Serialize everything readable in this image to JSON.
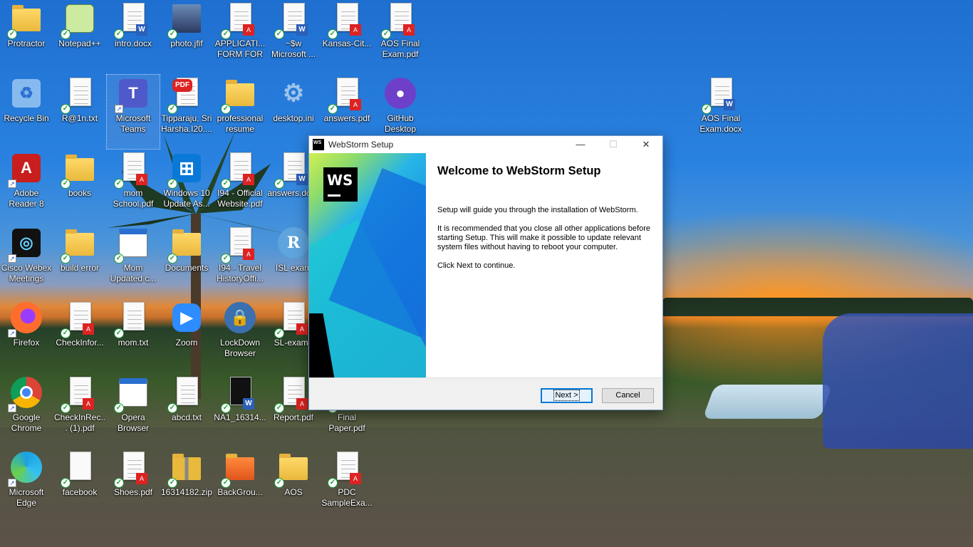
{
  "desktop": {
    "icons": [
      {
        "label": "Protractor",
        "kind": "folder"
      },
      {
        "label": "Notepad++",
        "kind": "notepadpp"
      },
      {
        "label": "intro.docx",
        "kind": "word"
      },
      {
        "label": "photo.jfif",
        "kind": "photo"
      },
      {
        "label": "APPLICATI... FORM FOR ...",
        "kind": "pdf"
      },
      {
        "label": "~$w Microsoft ...",
        "kind": "word"
      },
      {
        "label": "Kansas-Cit...",
        "kind": "pdf"
      },
      {
        "label": "AOS Final Exam.pdf",
        "kind": "pdf"
      },
      {
        "label": "Recycle Bin",
        "kind": "recycle"
      },
      {
        "label": "R@1n.txt",
        "kind": "txt"
      },
      {
        "label": "Microsoft Teams",
        "kind": "teams"
      },
      {
        "label": "Tipparaju, Sri Harsha.I20....",
        "kind": "adobe"
      },
      {
        "label": "professional resume",
        "kind": "folder"
      },
      {
        "label": "desktop.ini",
        "kind": "gear"
      },
      {
        "label": "answers.pdf",
        "kind": "pdf"
      },
      {
        "label": "GitHub Desktop",
        "kind": "github"
      },
      {
        "label": "AOS Final Exam.docx",
        "kind": "word"
      },
      {
        "label": "Adobe Reader 8",
        "kind": "adobe-reader"
      },
      {
        "label": "books",
        "kind": "folder"
      },
      {
        "label": "mom School.pdf",
        "kind": "pdf"
      },
      {
        "label": "Windows 10 Update As...",
        "kind": "windows"
      },
      {
        "label": "I94 - Official Website.pdf",
        "kind": "pdf"
      },
      {
        "label": "answers.docx",
        "kind": "word"
      },
      {
        "label": "Cisco Webex Meetings",
        "kind": "webex"
      },
      {
        "label": "build error",
        "kind": "folder"
      },
      {
        "label": "Mom Updated c...",
        "kind": "window"
      },
      {
        "label": "Documents",
        "kind": "folder"
      },
      {
        "label": "I94 - Travel HistoryOffi...",
        "kind": "pdf"
      },
      {
        "label": "ISL exam",
        "kind": "r-app"
      },
      {
        "label": "Firefox",
        "kind": "firefox"
      },
      {
        "label": "CheckInfor...",
        "kind": "pdf"
      },
      {
        "label": "mom.txt",
        "kind": "txt"
      },
      {
        "label": "Zoom",
        "kind": "zoom"
      },
      {
        "label": "LockDown Browser",
        "kind": "lockdown"
      },
      {
        "label": "SL-exam#",
        "kind": "pdf"
      },
      {
        "label": "Google Chrome",
        "kind": "chrome"
      },
      {
        "label": "CheckInRec... (1).pdf",
        "kind": "pdf"
      },
      {
        "label": "Opera Browser",
        "kind": "window"
      },
      {
        "label": "abcd.txt",
        "kind": "txt"
      },
      {
        "label": "NA1_16314...",
        "kind": "word-dark"
      },
      {
        "label": "Report.pdf",
        "kind": "pdf"
      },
      {
        "label": "Final Paper.pdf",
        "kind": "pdf"
      },
      {
        "label": "Microsoft Edge",
        "kind": "edge"
      },
      {
        "label": "facebook",
        "kind": "blank"
      },
      {
        "label": "Shoes.pdf",
        "kind": "pdf"
      },
      {
        "label": "16314182.zip",
        "kind": "zip"
      },
      {
        "label": "BackGrou...",
        "kind": "orange-folder"
      },
      {
        "label": "AOS",
        "kind": "folder"
      },
      {
        "label": "PDC SampleExa...",
        "kind": "pdf"
      }
    ]
  },
  "setup_window": {
    "title": "WebStorm Setup",
    "controls": {
      "minimize": "—",
      "maximize": "☐",
      "close": "✕"
    },
    "logo_text": "WS",
    "heading": "Welcome to WebStorm Setup",
    "paragraphs": [
      "Setup will guide you through the installation of WebStorm.",
      "It is recommended that you close all other applications before starting Setup. This will make it possible to update relevant system files without having to reboot your computer.",
      "Click Next to continue."
    ],
    "buttons": {
      "next": "Next >",
      "cancel": "Cancel"
    }
  }
}
